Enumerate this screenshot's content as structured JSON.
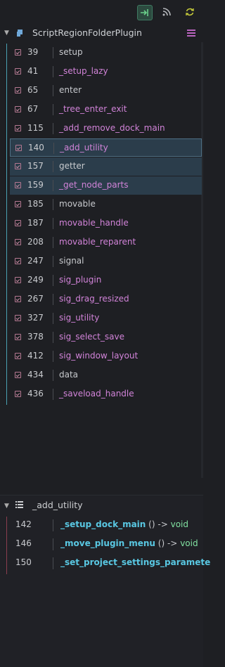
{
  "toolbar": {
    "buttons": [
      {
        "name": "enter-icon",
        "active": true
      },
      {
        "name": "rss-icon",
        "active": false
      },
      {
        "name": "refresh-icon",
        "active": false
      }
    ]
  },
  "tree": {
    "title": "ScriptRegionFolderPlugin",
    "rows": [
      {
        "line": "39",
        "name": "setup",
        "kind": "plain"
      },
      {
        "line": "41",
        "name": "_setup_lazy",
        "kind": "func"
      },
      {
        "line": "65",
        "name": "enter",
        "kind": "plain"
      },
      {
        "line": "67",
        "name": "_tree_enter_exit",
        "kind": "func"
      },
      {
        "line": "115",
        "name": "_add_remove_dock_main",
        "kind": "func"
      },
      {
        "line": "140",
        "name": "_add_utility",
        "kind": "func",
        "selected": true,
        "current": true
      },
      {
        "line": "157",
        "name": "getter",
        "kind": "plain",
        "selected": true
      },
      {
        "line": "159",
        "name": "_get_node_parts",
        "kind": "func",
        "selected": true
      },
      {
        "line": "185",
        "name": "movable",
        "kind": "plain"
      },
      {
        "line": "187",
        "name": "movable_handle",
        "kind": "func"
      },
      {
        "line": "208",
        "name": "movable_reparent",
        "kind": "func"
      },
      {
        "line": "247",
        "name": "signal",
        "kind": "plain"
      },
      {
        "line": "249",
        "name": "sig_plugin",
        "kind": "func"
      },
      {
        "line": "267",
        "name": "sig_drag_resized",
        "kind": "func"
      },
      {
        "line": "327",
        "name": "sig_utility",
        "kind": "func"
      },
      {
        "line": "378",
        "name": "sig_select_save",
        "kind": "func"
      },
      {
        "line": "412",
        "name": "sig_window_layout",
        "kind": "func"
      },
      {
        "line": "434",
        "name": "data",
        "kind": "plain"
      },
      {
        "line": "436",
        "name": "_saveload_handle",
        "kind": "func"
      }
    ]
  },
  "outline": {
    "title": "_add_utility",
    "functions": [
      {
        "line": "142",
        "name": "_setup_dock_main",
        "params": "()",
        "arrow": "->",
        "returns": "void"
      },
      {
        "line": "146",
        "name": "_move_plugin_menu",
        "params": "()",
        "arrow": "->",
        "returns": "void"
      },
      {
        "line": "150",
        "name": "_set_project_settings_paramete",
        "params": "",
        "arrow": "",
        "returns": ""
      }
    ]
  },
  "colors": {
    "accent_tree": "#4aa1b3",
    "accent_outline": "#8a3e4f",
    "function": "#d183d8",
    "method": "#59c8e3",
    "return_type": "#80e0a0"
  }
}
